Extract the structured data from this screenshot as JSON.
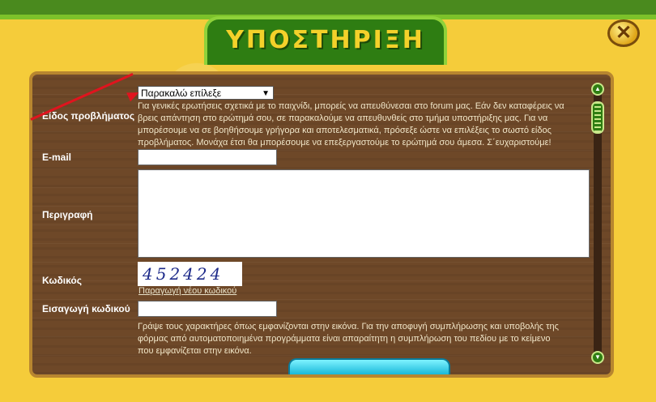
{
  "window": {
    "title": "ΥΠΟΣΤΗΡΙΞΗ",
    "close_label": "✕"
  },
  "form": {
    "problem_type": {
      "label": "Είδος προβλήματος",
      "selected": "Παρακαλώ επίλεξε",
      "info": [
        "Για γενικές ερωτήσεις σχετικά με το παιχνίδι, μπορείς να απευθύνεσαι στο forum μας. Εάν δεν καταφέρεις να",
        "βρεις απάντηση στο ερώτημά σου, σε παρακαλούμε να απευθυνθείς στο τμήμα υποστήριξης μας. Για να",
        "μπορέσουμε να σε βοηθήσουμε γρήγορα και αποτελεσματικά, πρόσεξε ώστε να επιλέξεις το σωστό είδος",
        "προβλήματος. Μονάχα έτσι θα μπορέσουμε να επεξεργαστούμε το ερώτημά σου άμεσα. Σ΄ευχαριστούμε!"
      ]
    },
    "email": {
      "label": "E-mail",
      "value": ""
    },
    "description": {
      "label": "Περιγραφή",
      "value": ""
    },
    "code": {
      "label": "Κωδικός",
      "captcha": "452424",
      "new_code_link": "Παραγωγή νέου κωδικού"
    },
    "code_entry": {
      "label": "Εισαγωγή κωδικού",
      "value": "",
      "info": [
        "Γράψε τους χαρακτήρες όπως εμφανίζονται στην εικόνα. Για την αποφυγή συμπλήρωσης και υποβολής της",
        "φόρμας από αυτοματοποιημένα προγράμματα είναι απαραίτητη η συμπλήρωση του πεδίου με το κείμενο",
        "που εμφανίζεται στην εικόνα."
      ]
    }
  },
  "colors": {
    "panel": "#6e4828",
    "frame": "#f5cc3a",
    "title": "#f4d12a",
    "arrow": "#e0141e"
  }
}
